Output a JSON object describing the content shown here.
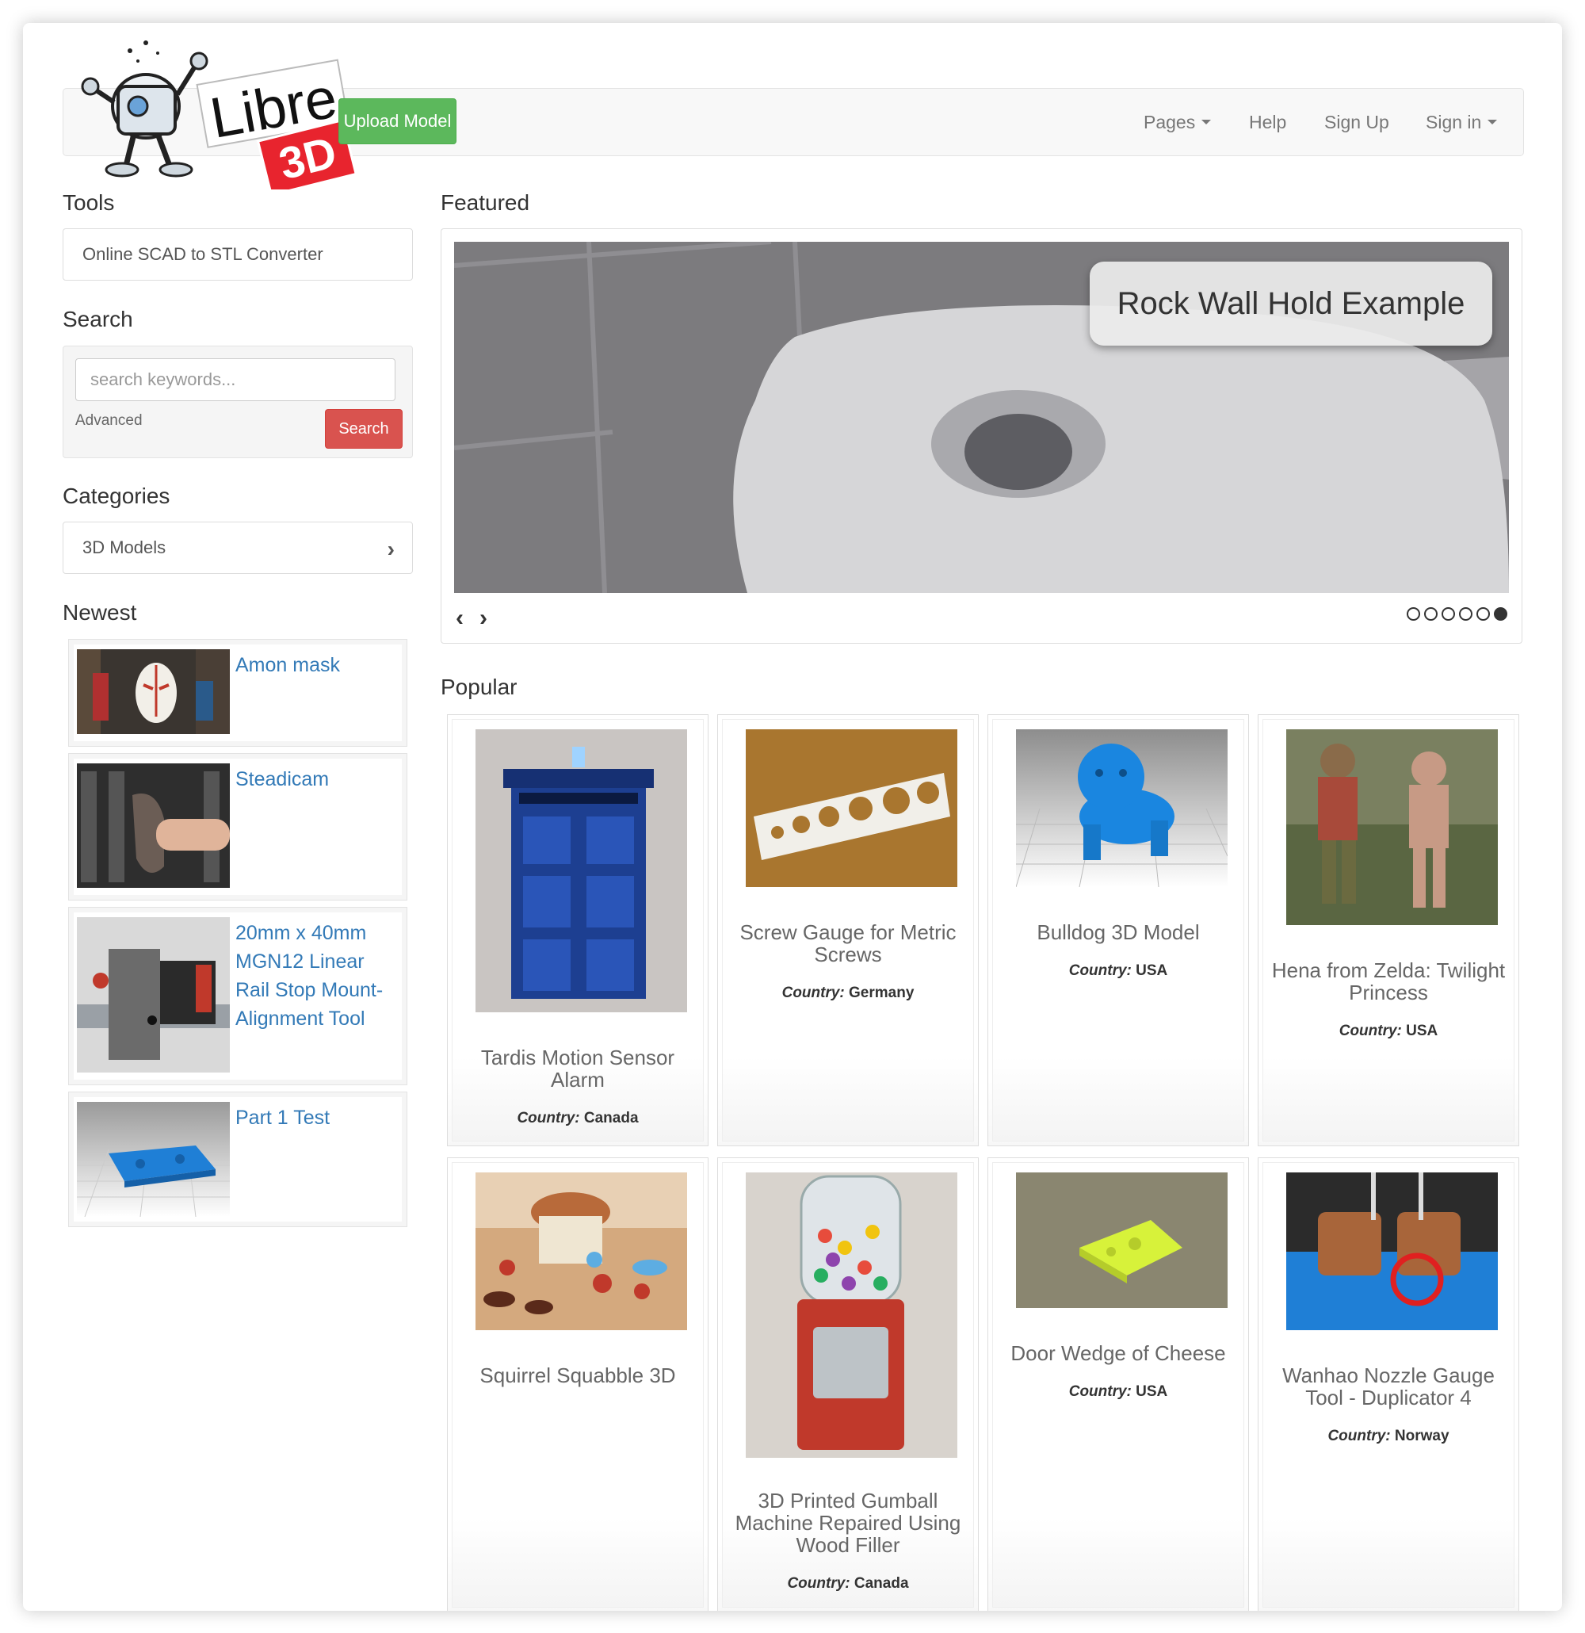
{
  "brand": {
    "name_line1": "Libre",
    "name_line2": "3D"
  },
  "header": {
    "upload_label": "Upload Model",
    "nav": {
      "pages": "Pages",
      "help": "Help",
      "signup": "Sign Up",
      "signin": "Sign in"
    }
  },
  "sidebar": {
    "tools_heading": "Tools",
    "tool_link": "Online SCAD to STL Converter",
    "search_heading": "Search",
    "search_placeholder": "search keywords...",
    "advanced_label": "Advanced",
    "search_button": "Search",
    "categories_heading": "Categories",
    "category": "3D Models",
    "newest_heading": "Newest",
    "newest": [
      {
        "title": "Amon mask"
      },
      {
        "title": "Steadicam"
      },
      {
        "title": "20mm x 40mm MGN12 Linear Rail Stop Mount-Alignment Tool"
      },
      {
        "title": "Part 1 Test"
      }
    ]
  },
  "featured": {
    "heading": "Featured",
    "caption": "Rock Wall Hold Example",
    "slide_count": 6,
    "active_slide": 6
  },
  "popular": {
    "heading": "Popular",
    "country_label": "Country:",
    "items": [
      {
        "title": "Tardis Motion Sensor Alarm",
        "country": "Canada"
      },
      {
        "title": "Screw Gauge for Metric Screws",
        "country": "Germany"
      },
      {
        "title": "Bulldog 3D Model",
        "country": "USA"
      },
      {
        "title": "Hena from Zelda: Twilight Princess",
        "country": "USA"
      },
      {
        "title": "Squirrel Squabble 3D",
        "country": ""
      },
      {
        "title": "3D Printed Gumball Machine Repaired Using Wood Filler",
        "country": "Canada"
      },
      {
        "title": "Door Wedge of Cheese",
        "country": "USA"
      },
      {
        "title": "Wanhao Nozzle Gauge Tool - Duplicator 4",
        "country": "Norway"
      }
    ]
  },
  "colors": {
    "upload": "#5cb85c",
    "search": "#d9534f",
    "link": "#337ab7",
    "logo_red": "#e8242e"
  }
}
